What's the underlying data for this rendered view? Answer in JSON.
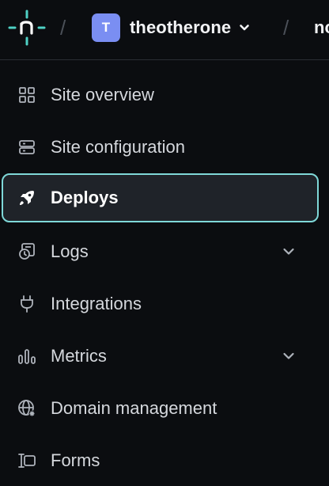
{
  "header": {
    "separator": "/",
    "team": {
      "avatar_letter": "T",
      "name": "theotherone",
      "avatar_color": "#7a8ef2"
    },
    "site_crumb": "nc"
  },
  "nav": {
    "items": [
      {
        "label": "Site overview",
        "icon": "grid-icon",
        "active": false,
        "expandable": false
      },
      {
        "label": "Site configuration",
        "icon": "server-config-icon",
        "active": false,
        "expandable": false
      },
      {
        "label": "Deploys",
        "icon": "rocket-icon",
        "active": true,
        "expandable": false
      },
      {
        "label": "Logs",
        "icon": "logs-icon",
        "active": false,
        "expandable": true
      },
      {
        "label": "Integrations",
        "icon": "plug-icon",
        "active": false,
        "expandable": false
      },
      {
        "label": "Metrics",
        "icon": "bar-chart-icon",
        "active": false,
        "expandable": true
      },
      {
        "label": "Domain management",
        "icon": "globe-icon",
        "active": false,
        "expandable": false
      },
      {
        "label": "Forms",
        "icon": "forms-icon",
        "active": false,
        "expandable": false
      }
    ]
  },
  "colors": {
    "background": "#0b0d10",
    "accent": "#7fd8d8",
    "active_bg": "#1f2329"
  }
}
